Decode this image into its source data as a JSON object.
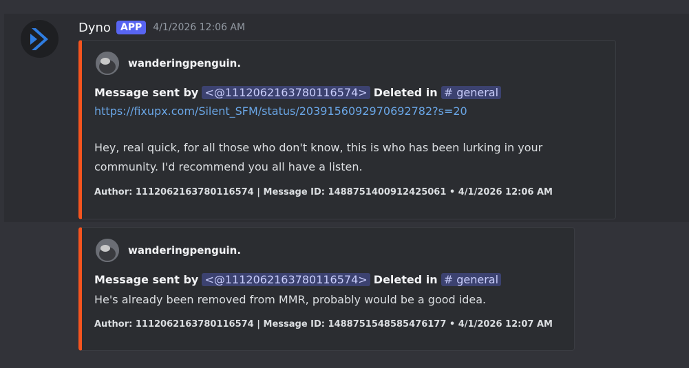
{
  "message": {
    "author": "Dyno",
    "badge": "APP",
    "timestamp": "4/1/2026 12:06 AM",
    "avatar_icon": "dyno-logo-icon"
  },
  "embeds": [
    {
      "author": "wanderingpenguin.",
      "sent_by_label": "Message sent by",
      "mention": "<@1112062163780116574>",
      "deleted_label": "Deleted in",
      "channel": "# general",
      "link": "https://fixupx.com/Silent_SFM/status/2039156092970692782?s=20",
      "body_line1": "Hey, real quick, for all those who don't know, this is who has been lurking in your",
      "body_line2": "community. I'd recommend you all have a listen.",
      "footer": "Author: 1112062163780116574 | Message ID: 1488751400912425061 • 4/1/2026 12:06 AM"
    },
    {
      "author": "wanderingpenguin.",
      "sent_by_label": "Message sent by",
      "mention": "<@1112062163780116574>",
      "deleted_label": "Deleted in",
      "channel": "# general",
      "body_line1": "He's already been removed from MMR, probably would be a good idea.",
      "footer": "Author: 1112062163780116574 | Message ID: 1488751548585476177 • 4/1/2026 12:07 AM"
    }
  ],
  "colors": {
    "accent": "#f5541f",
    "badge": "#5865f2",
    "link": "#6aa6e6"
  }
}
